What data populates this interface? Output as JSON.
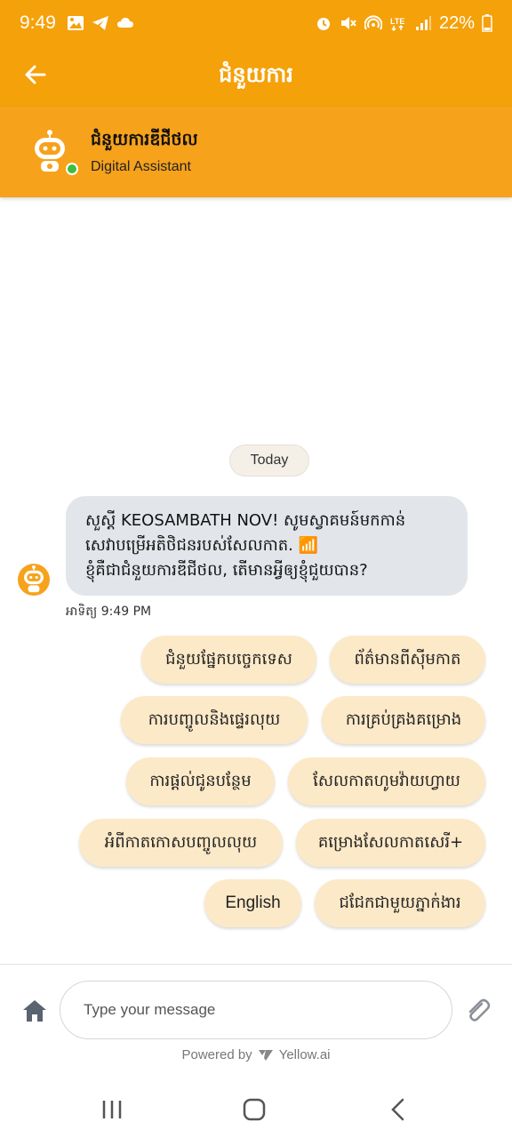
{
  "status_bar": {
    "time": "9:49",
    "battery": "22%",
    "network": "LTE",
    "icons": [
      "image-icon",
      "telegram-icon",
      "cloud-icon",
      "alarm-icon",
      "mute-icon",
      "hotspot-icon",
      "lte-icon",
      "signal-icon",
      "battery-icon"
    ]
  },
  "header": {
    "title": "ជំនួយការ",
    "back_icon": "arrow-left-icon"
  },
  "bot": {
    "name": "ជំនួយការឌីជីថល",
    "role": "Digital Assistant",
    "status": "online"
  },
  "chat": {
    "date_label": "Today",
    "messages": [
      {
        "lines": [
          "សួស្តី KEOSAMBATH NOV! សូមស្វាគមន៍មកកាន់",
          "សេវាបម្រើអតិថិជនរបស់សែលកាត. 📶",
          "ខ្ញុំគឺជាជំនួយការឌីជីថល, តើមានអ្វីឲ្យខ្ញុំជួយបាន?"
        ],
        "time": "អាទិត្យ 9:49 PM"
      }
    ],
    "quick_replies": [
      "ជំនួយផ្នែកបច្ចេកទេស",
      "ព័ត៌មានពីស៊ីមកាត",
      "ការបញ្ចូលនិងផ្ទេរលុយ",
      "ការគ្រប់គ្រងគម្រោង",
      "ការផ្តល់ជូនបន្ថែម",
      "សែលកាតហូមវ៉ាយហ្វាយ",
      "អំពីកាតកោសបញ្ចូលលុយ",
      "គម្រោងសែលកាតសេរី+",
      "English",
      "ជជែកជាមួយភ្នាក់ងារ"
    ]
  },
  "composer": {
    "placeholder": "Type your message",
    "powered_by": "Powered by",
    "brand": "Yellow.ai"
  },
  "colors": {
    "brand_orange": "#F5A10A",
    "bubble_bg": "#E2E6EA",
    "quick_reply_bg": "#FCE9C8",
    "online": "#3DBE3D"
  }
}
